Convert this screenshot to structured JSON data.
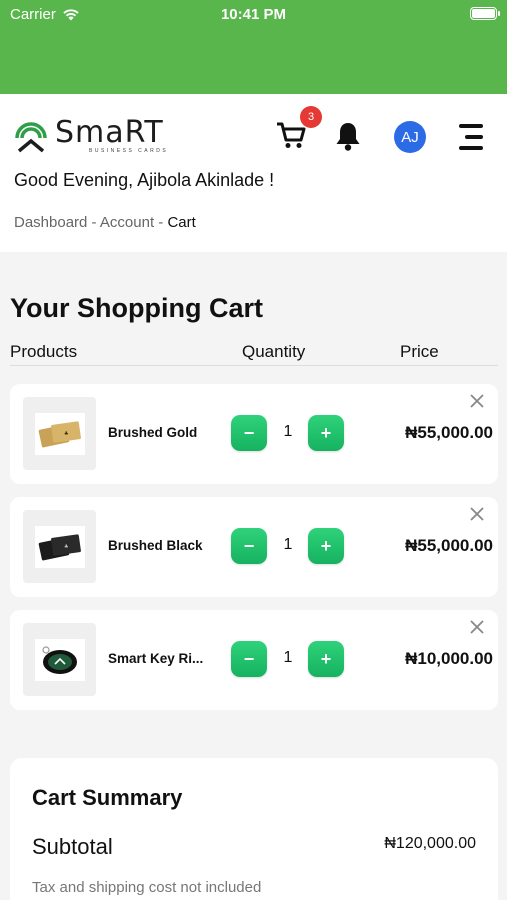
{
  "status_bar": {
    "carrier": "Carrier",
    "time": "10:41 PM",
    "battery_level": 1.0
  },
  "header": {
    "logo_word": "SmaRT",
    "logo_sub": "BUSINESS CARDS",
    "cart_count": "3",
    "avatar_initials": "AJ",
    "greeting": "Good Evening, Ajibola Akinlade !",
    "breadcrumb": {
      "item1": "Dashboard",
      "sep1": " - ",
      "item2": "Account",
      "sep2": " - ",
      "current": "Cart"
    }
  },
  "cart": {
    "title": "Your Shopping Cart",
    "columns": {
      "products": "Products",
      "quantity": "Quantity",
      "price": "Price"
    },
    "items": [
      {
        "name": "Brushed Gold",
        "quantity": "1",
        "price": "₦55,000.00",
        "minus": "−",
        "plus": "+",
        "image": "gold-card-image"
      },
      {
        "name": "Brushed Black",
        "quantity": "1",
        "price": "₦55,000.00",
        "minus": "−",
        "plus": "+",
        "image": "black-card-image"
      },
      {
        "name": "Smart Key Ri...",
        "quantity": "1",
        "price": "₦10,000.00",
        "minus": "−",
        "plus": "+",
        "image": "key-ring-image"
      }
    ]
  },
  "summary": {
    "title": "Cart Summary",
    "subtotal_label": "Subtotal",
    "subtotal_value": "₦120,000.00",
    "tax_note": "Tax and shipping cost not included"
  },
  "colors": {
    "status_bar": "#59b64d",
    "accent_green": "#1fc26a",
    "badge_red": "#e53935",
    "avatar_blue": "#2b6ce6"
  }
}
